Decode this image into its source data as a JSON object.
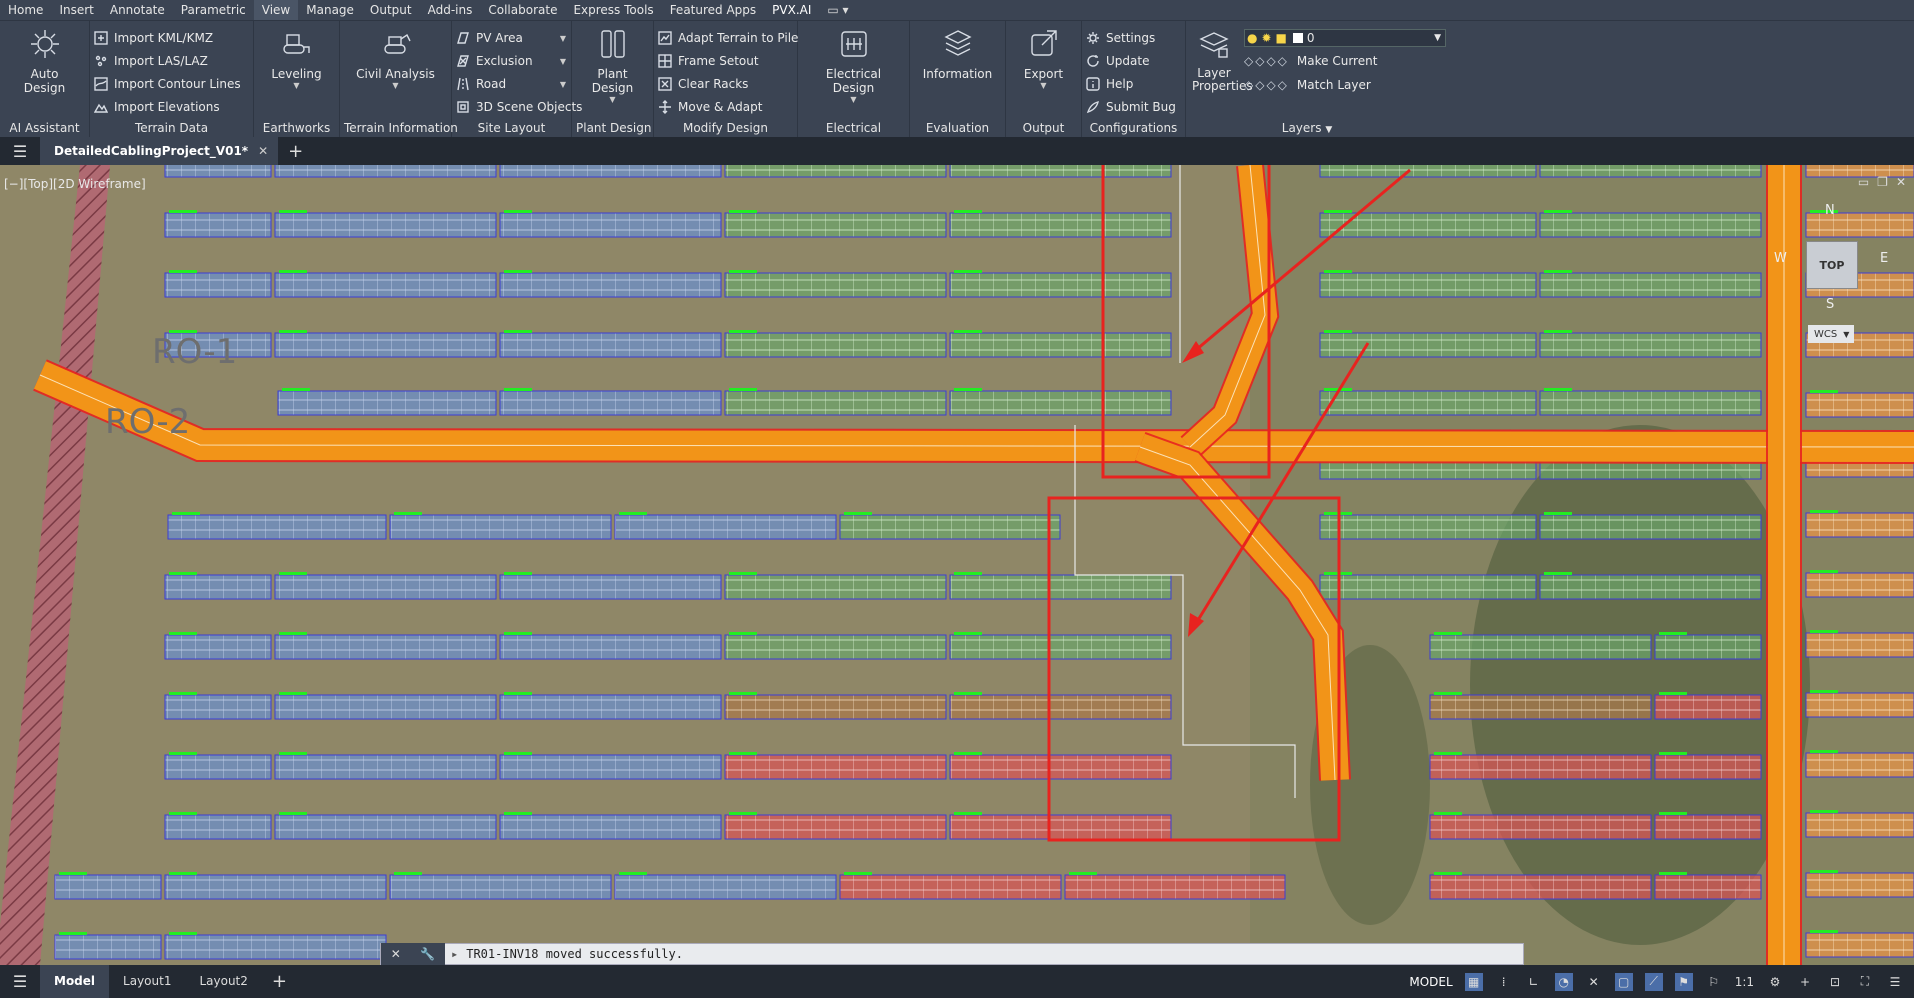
{
  "menu": {
    "tabs": [
      "Home",
      "Insert",
      "Annotate",
      "Parametric",
      "View",
      "Manage",
      "Output",
      "Add-ins",
      "Collaborate",
      "Express Tools",
      "Featured Apps",
      "PVX.AI"
    ],
    "active": "View"
  },
  "ribbon": {
    "ai_assistant": {
      "auto_design": "Auto Design",
      "title": "AI Assistant"
    },
    "terrain_data": {
      "items": [
        "Import KML/KMZ",
        "Import LAS/LAZ",
        "Import Contour Lines",
        "Import Elevations"
      ],
      "title": "Terrain Data"
    },
    "earthworks": {
      "leveling": "Leveling",
      "title": "Earthworks"
    },
    "terrain_information": {
      "civil_analysis": "Civil Analysis",
      "title": "Terrain Information"
    },
    "site_layout": {
      "items": [
        "PV Area",
        "Exclusion",
        "Road",
        "3D Scene Objects"
      ],
      "title": "Site Layout"
    },
    "plant_design": {
      "button": "Plant Design",
      "title": "Plant Design"
    },
    "modify_design": {
      "items": [
        "Adapt Terrain to Pile",
        "Frame Setout",
        "Clear Racks",
        "Move & Adapt"
      ],
      "title": "Modify Design"
    },
    "electrical": {
      "button": "Electrical Design",
      "title": "Electrical"
    },
    "evaluation": {
      "button": "Information",
      "title": "Evaluation"
    },
    "output": {
      "button": "Export",
      "title": "Output"
    },
    "configurations": {
      "items": [
        "Settings",
        "Update",
        "Help",
        "Submit Bug"
      ],
      "title": "Configurations"
    },
    "layers": {
      "layer_properties": "Layer Properties",
      "layer_value": "0",
      "make_current": "Make Current",
      "match_layer": "Match Layer",
      "title": "Layers"
    }
  },
  "document": {
    "tab_name": "DetailedCablingProject_V01*"
  },
  "viewport": {
    "label": "[−][Top][2D Wireframe]",
    "road_labels": [
      "RO-1",
      "RO-2"
    ],
    "viewcube": {
      "top": "TOP",
      "n": "N",
      "s": "S",
      "e": "E",
      "w": "W",
      "wcs": "WCS"
    },
    "colors": {
      "annotation": "#e8231f",
      "road": "#f29418",
      "blue_table": "#5a86c8",
      "green_table": "#6aa66a",
      "red_table": "#d65555"
    }
  },
  "command_line": {
    "message": "TR01-INV18 moved successfully."
  },
  "status": {
    "layout_tabs": [
      "Model",
      "Layout1",
      "Layout2"
    ],
    "active": "Model",
    "model_label": "MODEL",
    "scale": "1:1"
  }
}
